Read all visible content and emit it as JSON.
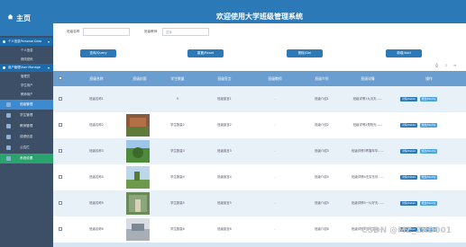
{
  "app": {
    "title": "主页",
    "system_title": "欢迎使用大学班级管理系统"
  },
  "sidebar": {
    "groups": [
      {
        "label": "个人信息Personal Data",
        "subs": [
          "个人信息",
          "修改密码"
        ]
      },
      {
        "label": "用户管理User Manage",
        "subs": [
          "管理员",
          "学生用户",
          "教师用户"
        ]
      }
    ],
    "items": [
      {
        "label": "班级管理",
        "active": false,
        "highlight": true
      },
      {
        "label": "学生管理"
      },
      {
        "label": "教师管理"
      },
      {
        "label": "成绩信息"
      },
      {
        "label": "公告栏"
      },
      {
        "label": "系统设置",
        "active": true
      }
    ]
  },
  "filters": {
    "f1_label": "班级名称",
    "f1_placeholder": "",
    "f2_label": "班级教师",
    "f2_placeholder": "选择"
  },
  "buttons": {
    "query": "查询/Query",
    "reset": "重置/Reset",
    "delete": "删除/Del",
    "add": "新增/Add"
  },
  "table": {
    "headers": [
      "班级名称",
      "班级封面",
      "学生数量",
      "班级宣言",
      "班级教师",
      "班级介绍",
      "班级详情",
      "操作"
    ],
    "rows": [
      {
        "name": "班级名称1",
        "count": "5",
        "slogan": "班级宣言1",
        "teacher": "-",
        "intro": "班级介绍1",
        "detail": "班级详情1九月天……"
      },
      {
        "name": "班级名称2",
        "count": "学生数量2",
        "slogan": "班级宣言2",
        "teacher": "-",
        "intro": "班级介绍2",
        "detail": "班级详情2是阳光……"
      },
      {
        "name": "班级名称3",
        "count": "学生数量3",
        "slogan": "班级宣言3",
        "teacher": "-",
        "intro": "班级介绍3",
        "detail": "班级详情3青春年华……"
      },
      {
        "name": "班级名称4",
        "count": "学生数量4",
        "slogan": "班级宣言4",
        "teacher": "-",
        "intro": "班级介绍4",
        "detail": "班级详情4无穷无尽……"
      },
      {
        "name": "班级名称5",
        "count": "学生数量5",
        "slogan": "班级宣言5",
        "teacher": "-",
        "intro": "班级介绍5",
        "detail": "班级详情5一片好天……"
      },
      {
        "name": "班级名称6",
        "count": "学生数量6",
        "slogan": "班级宣言6",
        "teacher": "-",
        "intro": "班级介绍6",
        "detail": "班级详情6当下生活……"
      }
    ],
    "action_labels": [
      "详情/Detail",
      "修改/Modify"
    ]
  },
  "watermark": "CSDN @MZ_ZXD001",
  "colors": {
    "sidebar": "#3c4f66",
    "topbar": "#2c79b8",
    "table_header": "#6a9ed0",
    "row_alt": "#e8f0f8"
  }
}
